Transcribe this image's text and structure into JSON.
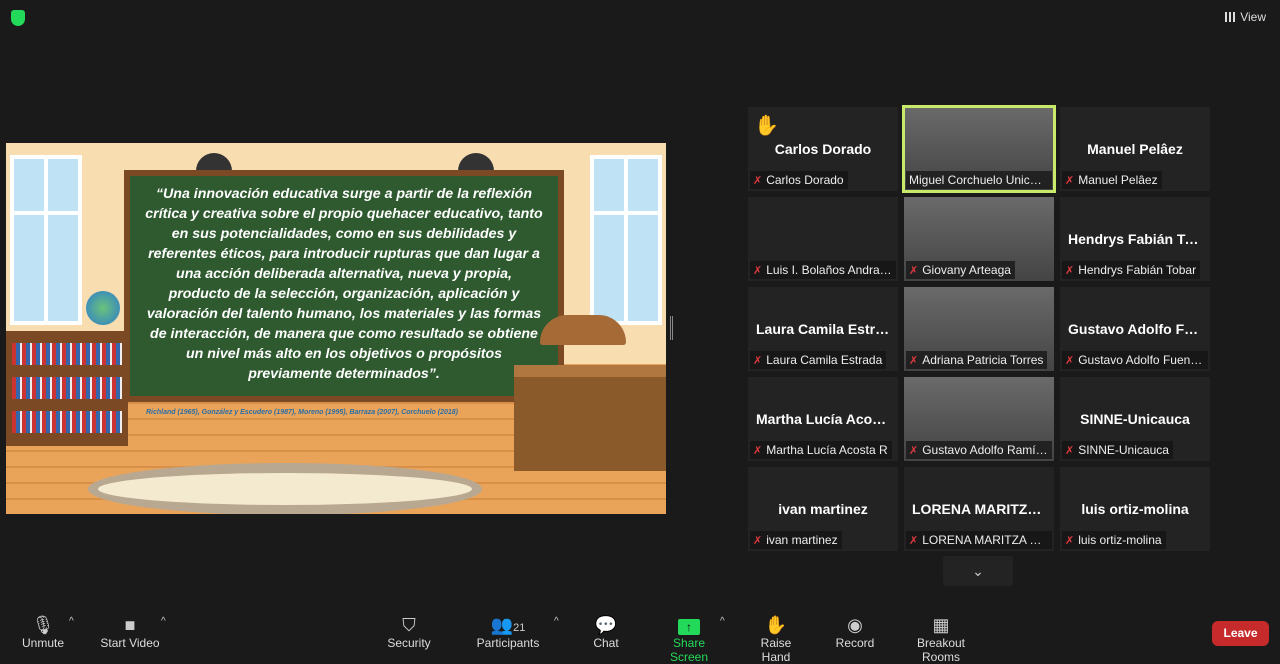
{
  "top": {
    "view_label": "View",
    "security_color": "#23d959"
  },
  "slide": {
    "quote": "“Una innovación educativa surge a partir de la reflexión crítica y creativa  sobre el propio quehacer  educativo, tanto en sus potencialidades, como en sus debilidades y referentes éticos, para introducir rupturas que dan lugar a una acción deliberada alternativa, nueva y propia, producto de la selección, organización, aplicación y valoración del talento humano, los materiales y las formas de interacción, de manera que como resultado se obtiene un nivel más alto en los objetivos o propósitos previamente determinados”.",
    "citation": "Richland (1965), González y Escudero (1987), Moreno (1995), Barraza (2007), Corchuelo (2018)"
  },
  "participants": [
    {
      "big": "Carlos Dorado",
      "label": "Carlos Dorado",
      "muted": true,
      "hand": true
    },
    {
      "big": "",
      "label": "Miguel Corchuelo  Unicauca",
      "muted": false,
      "video": true,
      "active": true
    },
    {
      "big": "Manuel Pelâez",
      "label": "Manuel Pelâez",
      "muted": true
    },
    {
      "big": "",
      "label": "Luis I. Bolaños Andrade",
      "muted": true
    },
    {
      "big": "",
      "label": "Giovany Arteaga",
      "muted": true,
      "video": true
    },
    {
      "big": "Hendrys  Fabián Tobar",
      "label": "Hendrys Fabián Tobar",
      "muted": true
    },
    {
      "big": "Laura Camila Estrada",
      "label": "Laura Camila Estrada",
      "muted": true
    },
    {
      "big": "",
      "label": "Adriana Patricia Torres",
      "muted": true,
      "video": true
    },
    {
      "big": "Gustavo  Adolfo Fuentes",
      "label": "Gustavo Adolfo Fuentes",
      "muted": true
    },
    {
      "big": "Martha Lucía Acosta R",
      "label": "Martha Lucía Acosta R",
      "muted": true
    },
    {
      "big": "",
      "label": "Gustavo Adolfo Ramírez",
      "muted": true,
      "video": true
    },
    {
      "big": "SINNE-Unicauca",
      "label": "SINNE-Unicauca",
      "muted": true
    },
    {
      "big": "ivan martinez",
      "label": "ivan martinez",
      "muted": true
    },
    {
      "big": "LORENA MARITZA TELLO",
      "label": "LORENA MARITZA TELLO",
      "muted": true
    },
    {
      "big": "luis ortiz-molina",
      "label": "luis ortiz-molina",
      "muted": true
    }
  ],
  "toolbar": {
    "unmute": "Unmute",
    "start_video": "Start Video",
    "security": "Security",
    "participants": "Participants",
    "participants_count": "21",
    "chat": "Chat",
    "share_screen": "Share Screen",
    "raise_hand": "Raise Hand",
    "record": "Record",
    "breakout": "Breakout Rooms",
    "leave": "Leave",
    "share_color": "#23d959",
    "leave_color": "#c72a2a"
  }
}
